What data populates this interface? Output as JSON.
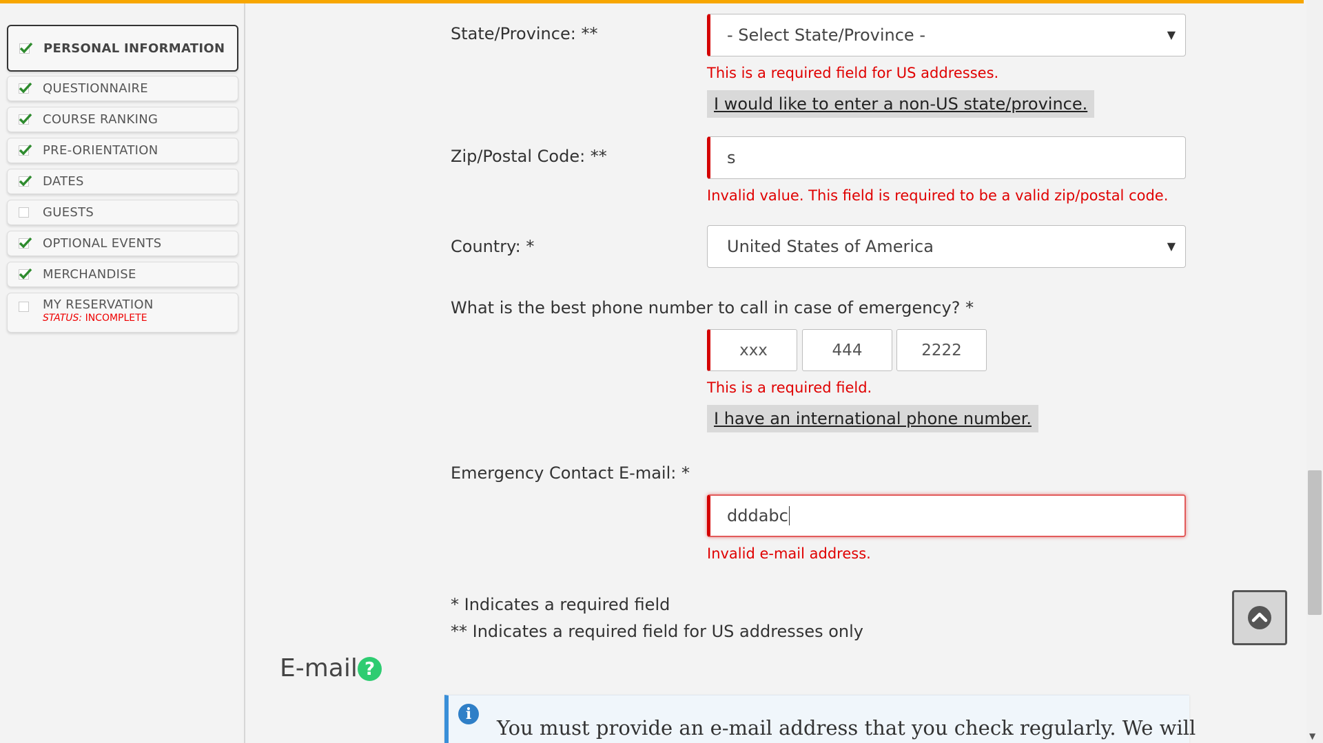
{
  "sidebar": {
    "items": [
      {
        "label": "PERSONAL INFORMATION",
        "checked": true,
        "active": true
      },
      {
        "label": "QUESTIONNAIRE",
        "checked": true
      },
      {
        "label": "COURSE RANKING",
        "checked": true
      },
      {
        "label": "PRE-ORIENTATION",
        "checked": true
      },
      {
        "label": "DATES",
        "checked": true
      },
      {
        "label": "GUESTS",
        "checked": false
      },
      {
        "label": "OPTIONAL EVENTS",
        "checked": true
      },
      {
        "label": "MERCHANDISE",
        "checked": true
      },
      {
        "label": "MY RESERVATION",
        "checked": false,
        "status_label": "STATUS:",
        "status_value": "INCOMPLETE"
      }
    ]
  },
  "form": {
    "state": {
      "label": "State/Province: **",
      "value": "- Select State/Province -",
      "error": "This is a required field for US addresses.",
      "alt_link": "I would like to enter a non-US state/province."
    },
    "zip": {
      "label": "Zip/Postal Code: **",
      "value": "s",
      "error": "Invalid value. This field is required to be a valid zip/postal code."
    },
    "country": {
      "label": "Country: *",
      "value": "United States of America"
    },
    "phone": {
      "label": "What is the best phone number to call in case of emergency? *",
      "area_placeholder": "xxx",
      "prefix": "444",
      "line": "2222",
      "error": "This is a required field.",
      "alt_link": "I have an international phone number."
    },
    "emergency_email": {
      "label": "Emergency Contact E-mail: *",
      "value": "dddabc",
      "error": "Invalid e-mail address."
    },
    "notes": {
      "required": "* Indicates a required field",
      "us_required": "** Indicates a required field for US addresses only"
    }
  },
  "email_section": {
    "title": "E-mail",
    "help_glyph": "?",
    "info_glyph": "i",
    "info_text": "You must provide an e-mail address that you check regularly. We will"
  },
  "colors": {
    "accent_top": "#f7a600",
    "error": "#e00000",
    "check": "#2e8b2e",
    "help": "#2ecc71",
    "info": "#2f7fc7"
  }
}
